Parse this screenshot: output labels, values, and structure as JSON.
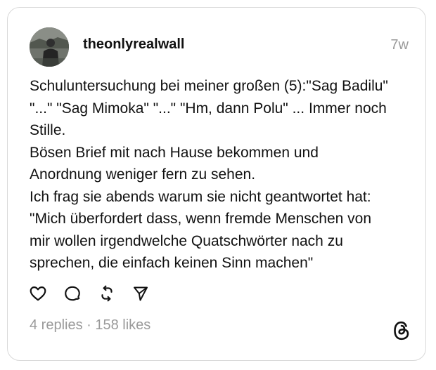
{
  "post": {
    "username": "theonlyrealwall",
    "time": "7w",
    "lines": [
      "Schuluntersuchung bei meiner großen (5):\"Sag Badilu\"",
      "\"...\" \"Sag Mimoka\" \"...\" \"Hm, dann Polu\" ... Immer noch",
      "Stille.",
      "Bösen Brief mit nach Hause bekommen und",
      "Anordnung weniger fern zu sehen.",
      "Ich frag sie abends warum sie nicht geantwortet hat:",
      "\"Mich überfordert dass, wenn fremde Menschen von",
      "mir wollen irgendwelche Quatschwörter nach zu",
      "sprechen, die einfach keinen Sinn machen\""
    ],
    "stats": "4 replies · 158 likes"
  },
  "icons": {
    "like": "heart-icon",
    "reply": "comment-bubble-icon",
    "repost": "repost-arrows-icon",
    "share": "send-icon",
    "brand": "threads-logo-icon"
  },
  "colors": {
    "text": "#111111",
    "muted": "#9a9a9a",
    "border": "#d9d9d9"
  }
}
